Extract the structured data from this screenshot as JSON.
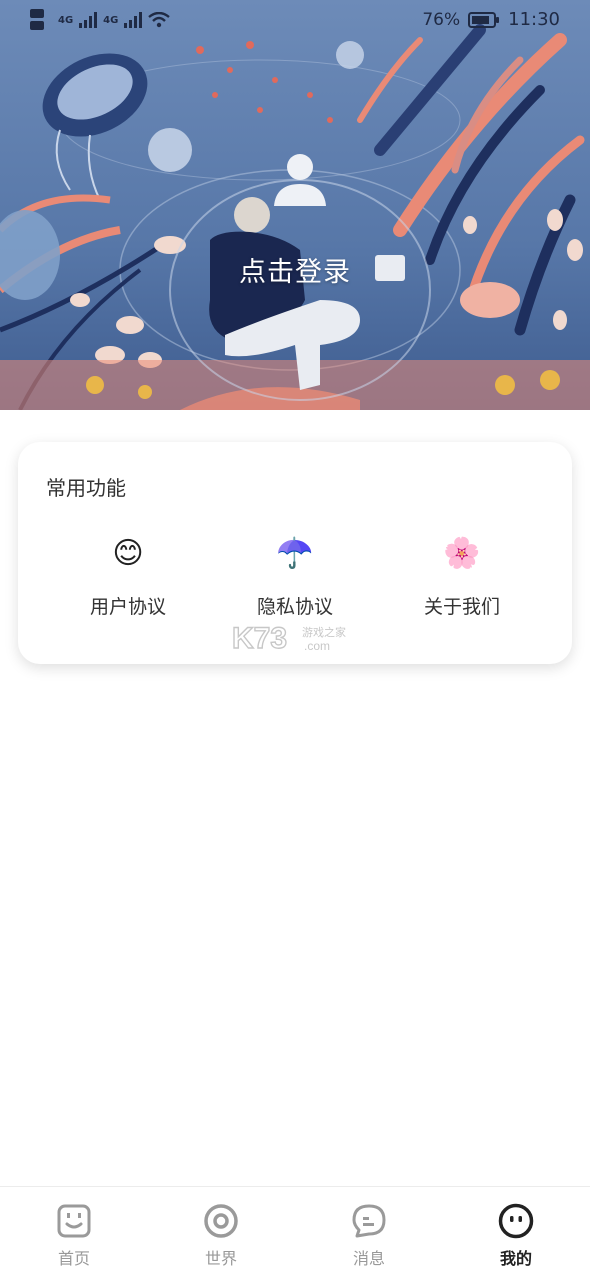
{
  "status_bar": {
    "network_left": "4G",
    "network_right": "4G",
    "battery_percent": "76%",
    "time": "11:30"
  },
  "header": {
    "login_text": "点击登录",
    "avatar_icon": "user-silhouette-icon"
  },
  "common_functions": {
    "title": "常用功能",
    "items": [
      {
        "emoji": "😊",
        "label": "用户协议",
        "icon": "smile-icon"
      },
      {
        "emoji": "☂️",
        "label": "隐私协议",
        "icon": "umbrella-icon"
      },
      {
        "emoji": "🌸",
        "label": "关于我们",
        "icon": "blossom-icon"
      }
    ]
  },
  "tabbar": {
    "tabs": [
      {
        "label": "首页",
        "icon": "home-face-icon"
      },
      {
        "label": "世界",
        "icon": "world-ring-icon"
      },
      {
        "label": "消息",
        "icon": "message-bubble-icon"
      },
      {
        "label": "我的",
        "icon": "profile-face-icon",
        "active": true
      }
    ]
  },
  "watermark": {
    "brand": "K73",
    "sub": "游戏之家",
    "domain": ".com"
  },
  "colors": {
    "hero_base": "#5e7fae",
    "hero_coral": "#e98a76",
    "hero_navy": "#1e2f5e",
    "tab_inactive": "#999999",
    "tab_active": "#222222"
  }
}
